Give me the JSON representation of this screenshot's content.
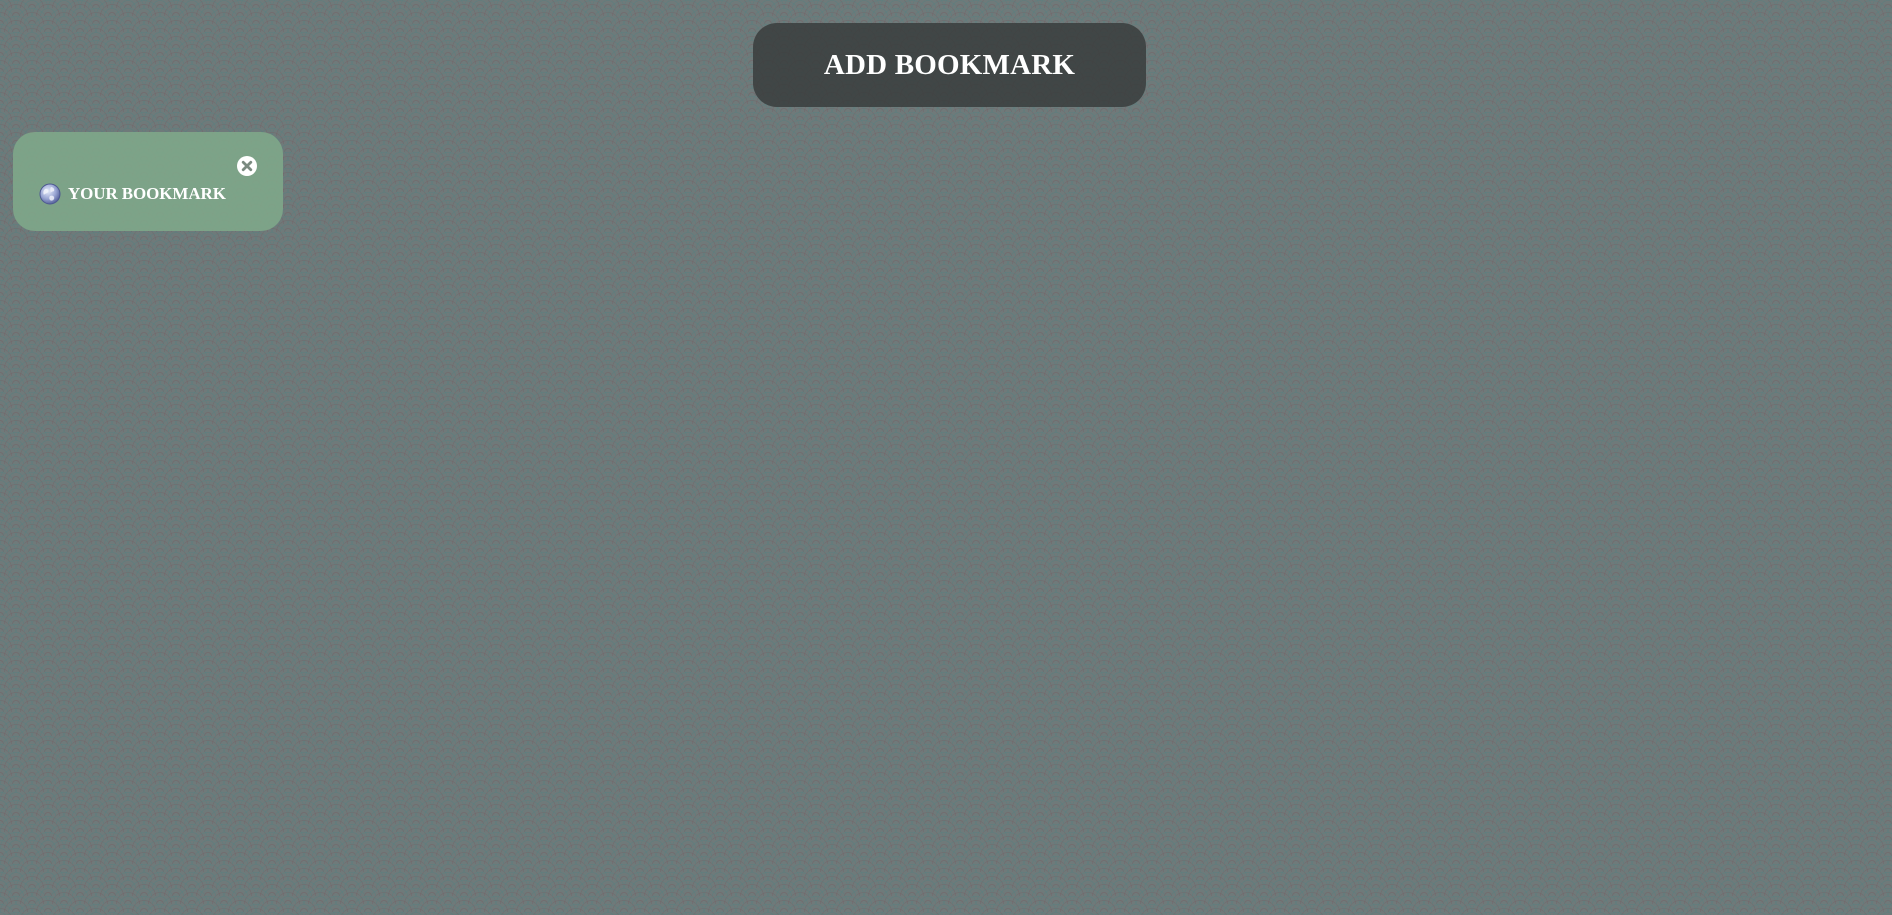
{
  "header": {
    "add_bookmark_label": "ADD BOOKMARK"
  },
  "bookmarks": [
    {
      "label": "YOUR BOOKMARK",
      "icon": "globe-icon",
      "close_icon": "close-icon"
    }
  ],
  "colors": {
    "background": "#6f7a7a",
    "add_button_bg": "#373a3a",
    "bookmark_card_bg": "#80a88a",
    "text": "#ffffff"
  }
}
